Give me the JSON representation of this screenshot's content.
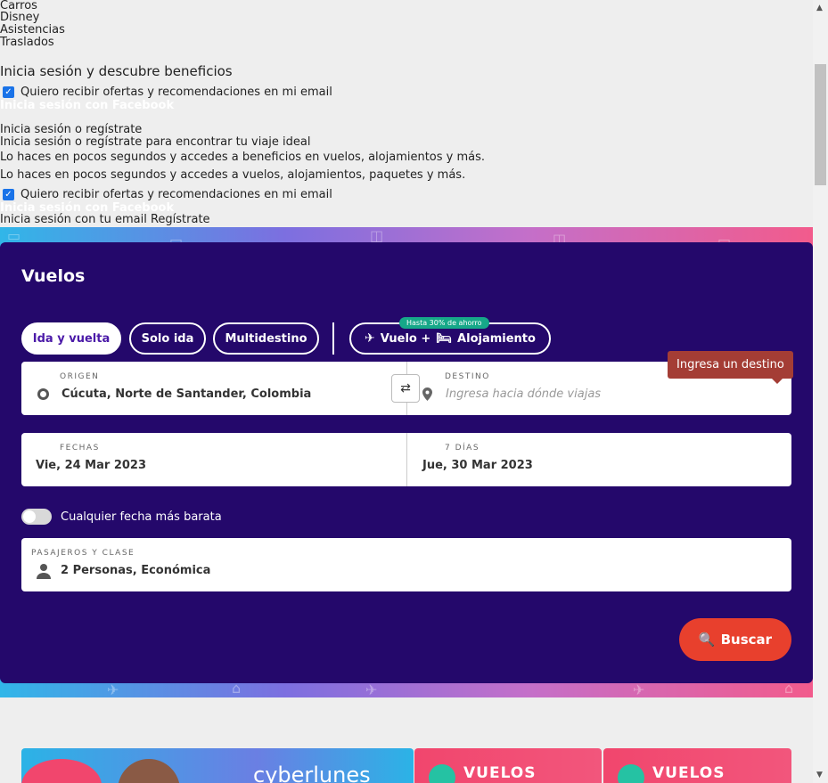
{
  "top_links": [
    "Carros",
    "Disney",
    "Asistencias",
    "Traslados"
  ],
  "benefits": {
    "heading": "Inicia sesión y descubre beneficios",
    "checkbox_1": "Quiero recibir ofertas y recomendaciones en mi email",
    "facebook_1": "Inicia sesión con Facebook",
    "login_title": "Inicia sesión o regístrate",
    "login_subtitle": "Inicia sesión o regístrate para encontrar tu viaje ideal",
    "text_1": "Lo haces en pocos segundos y accedes a beneficios en vuelos, alojamientos y más.",
    "text_2": "Lo haces en pocos segundos y accedes a vuelos, alojamientos, paquetes y más.",
    "checkbox_2": "Quiero recibir ofertas y recomendaciones en mi email",
    "facebook_2": "Inicia sesión con Facebook",
    "email_line": "Inicia sesión con tu email Regístrate"
  },
  "search": {
    "title": "Vuelos",
    "trip_types": {
      "round_trip": "Ida y vuelta",
      "one_way": "Solo ida",
      "multi": "Multidestino",
      "combo_flight": "Vuelo +",
      "combo_stay": "Alojamiento",
      "combo_badge": "Hasta 30% de ahorro"
    },
    "origin": {
      "label": "ORIGEN",
      "value": "Cúcuta, Norte de Santander, Colombia"
    },
    "destination": {
      "label": "DESTINO",
      "placeholder": "Ingresa hacia dónde viajas"
    },
    "tooltip": "Ingresa un destino",
    "dates": {
      "label": "FECHAS",
      "depart": "Vie, 24 Mar 2023",
      "nights_label": "7 DÍAS",
      "return": "Jue, 30 Mar 2023"
    },
    "cheapest_toggle": "Cualquier fecha más barata",
    "passengers": {
      "label": "PASAJEROS Y CLASE",
      "value": "2 Personas, Económica"
    },
    "search_button": "Buscar"
  },
  "promos": {
    "cyber": "cyberlunes",
    "vuelos_1": "VUELOS",
    "vuelos_2": "VUELOS"
  },
  "colors": {
    "card_bg": "#24086b",
    "accent_button": "#e8402d",
    "badge": "#16a889",
    "tooltip": "#a43d35"
  }
}
